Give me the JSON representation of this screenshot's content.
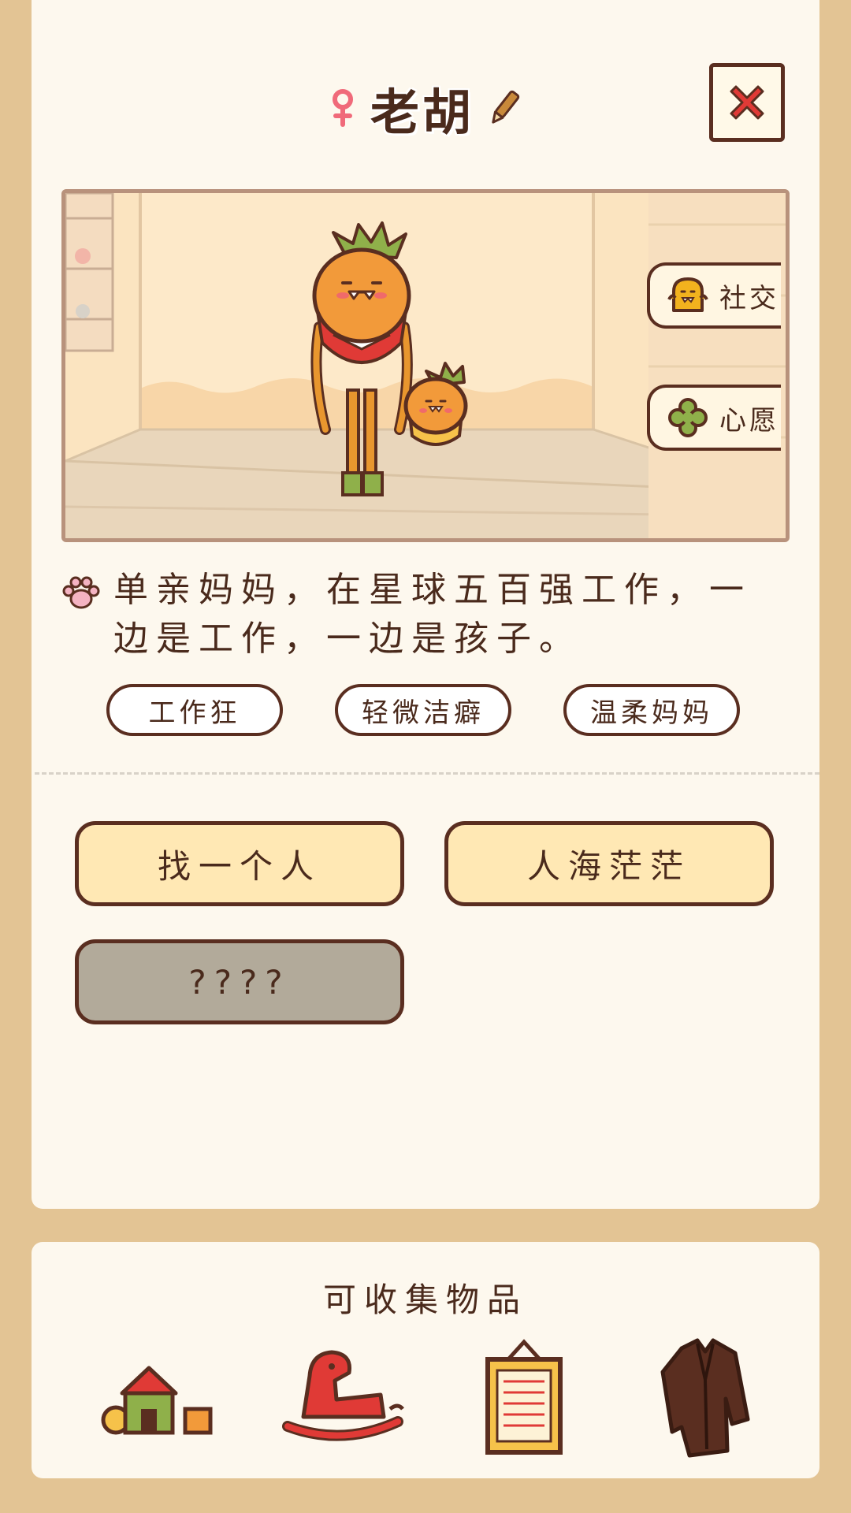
{
  "character": {
    "name": "老胡",
    "gender_icon": "female-icon",
    "description": "单亲妈妈，在星球五百强工作，一边是工作，一边是孩子。",
    "tags": [
      "工作狂",
      "轻微洁癖",
      "温柔妈妈"
    ]
  },
  "side_buttons": {
    "social": "社交",
    "wish": "心愿"
  },
  "actions": {
    "find_person": "找一个人",
    "sea_of_people": "人海茫茫",
    "locked": "????"
  },
  "collectibles": {
    "title": "可收集物品",
    "items": [
      "toy-blocks-icon",
      "rocking-horse-icon",
      "framed-certificate-icon",
      "jacket-icon"
    ]
  },
  "colors": {
    "background": "#e3c494",
    "card": "#fdf8ee",
    "outline": "#5a2e20",
    "button_yellow": "#ffe8b4",
    "button_locked": "#b2aa9a",
    "close_red": "#e03a36",
    "female_pink": "#f06a7a"
  }
}
